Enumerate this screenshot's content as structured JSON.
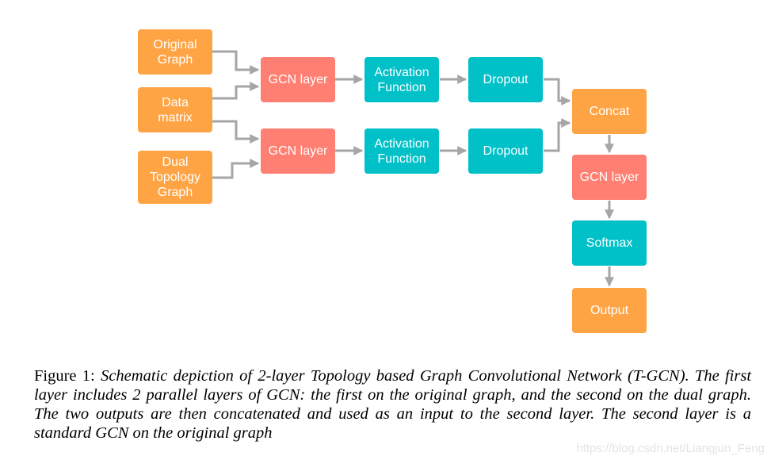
{
  "colors": {
    "input": "#FFA445",
    "gcn": "#FF7F72",
    "process": "#00C0C8",
    "edge": "#A6A6A6"
  },
  "nodes": {
    "original_graph": "Original\nGraph",
    "data_matrix": "Data\nmatrix",
    "dual_topology_graph": "Dual\nTopology\nGraph",
    "gcn_layer_1": "GCN layer",
    "gcn_layer_2": "GCN layer",
    "activation_1": "Activation\nFunction",
    "activation_2": "Activation\nFunction",
    "dropout_1": "Dropout",
    "dropout_2": "Dropout",
    "concat": "Concat",
    "gcn_layer_3": "GCN layer",
    "softmax": "Softmax",
    "output": "Output"
  },
  "edges": [
    [
      "original_graph",
      "gcn_layer_1"
    ],
    [
      "data_matrix",
      "gcn_layer_1"
    ],
    [
      "data_matrix",
      "gcn_layer_2"
    ],
    [
      "dual_topology_graph",
      "gcn_layer_2"
    ],
    [
      "gcn_layer_1",
      "activation_1"
    ],
    [
      "gcn_layer_2",
      "activation_2"
    ],
    [
      "activation_1",
      "dropout_1"
    ],
    [
      "activation_2",
      "dropout_2"
    ],
    [
      "dropout_1",
      "concat"
    ],
    [
      "dropout_2",
      "concat"
    ],
    [
      "concat",
      "gcn_layer_3"
    ],
    [
      "gcn_layer_3",
      "softmax"
    ],
    [
      "softmax",
      "output"
    ]
  ],
  "caption": {
    "label": "Figure 1:",
    "text": "Schematic depiction of 2-layer Topology based Graph Convolutional Network (T-GCN). The first layer includes 2 parallel layers of GCN: the first on the original graph, and the second on the dual graph. The two outputs are then concatenated and used as an input to the second layer. The second layer is a standard GCN on the original graph"
  },
  "watermark": "https://blog.csdn.net/Liangjun_Feng"
}
